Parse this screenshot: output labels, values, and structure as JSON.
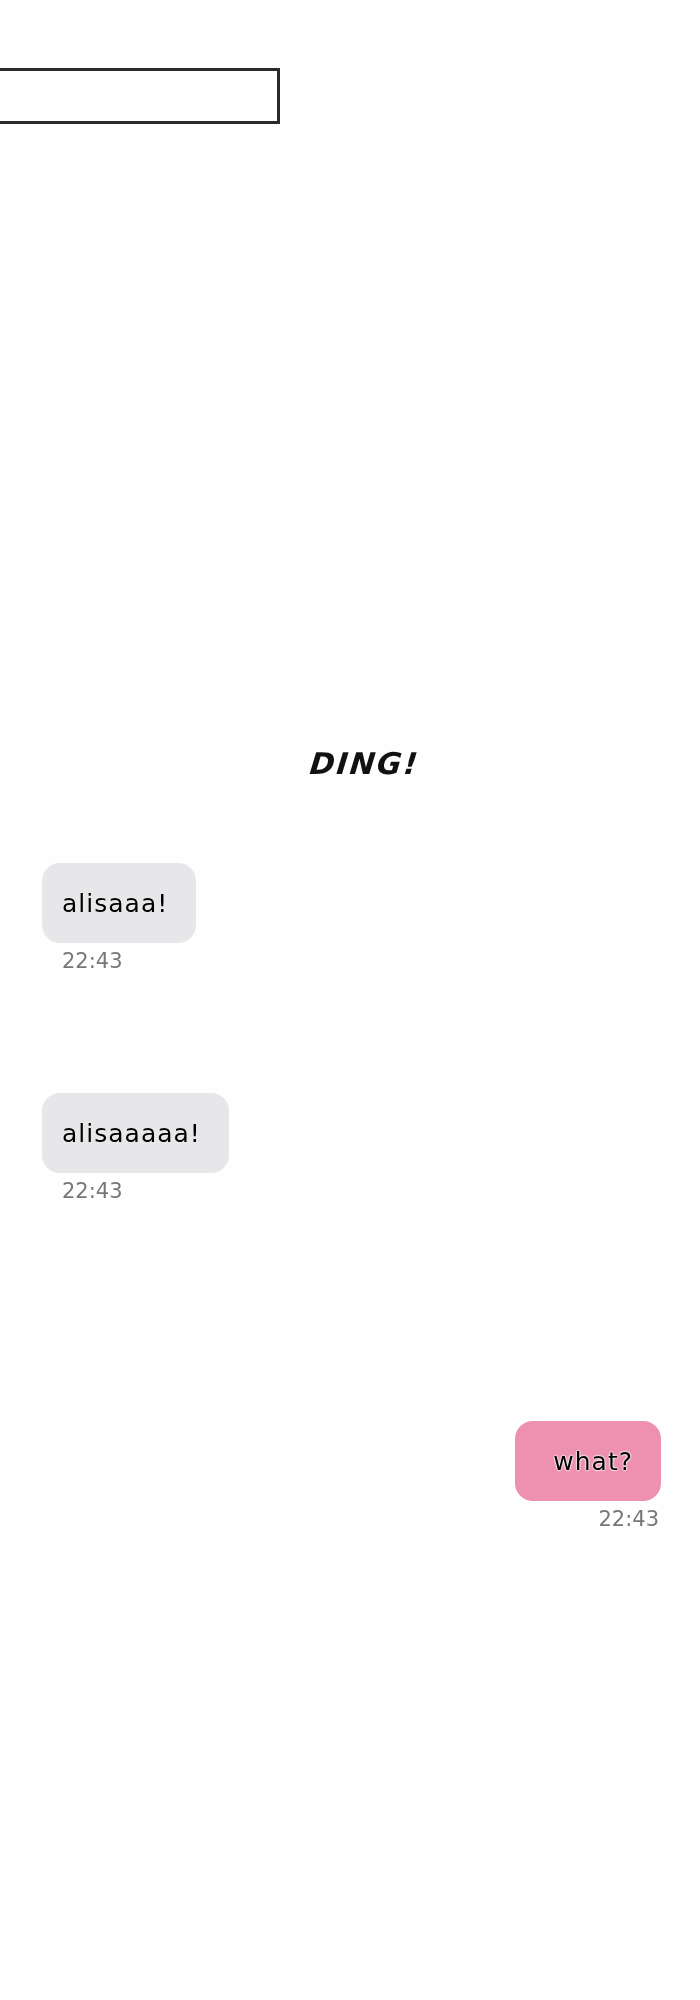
{
  "sound_effect": "DING!",
  "messages": [
    {
      "kind": "incoming",
      "text": "alisaaa!",
      "time": "22:43"
    },
    {
      "kind": "incoming",
      "text": "alisaaaaa!",
      "time": "22:43"
    },
    {
      "kind": "outgoing",
      "text": "what?",
      "time": "22:43"
    }
  ]
}
